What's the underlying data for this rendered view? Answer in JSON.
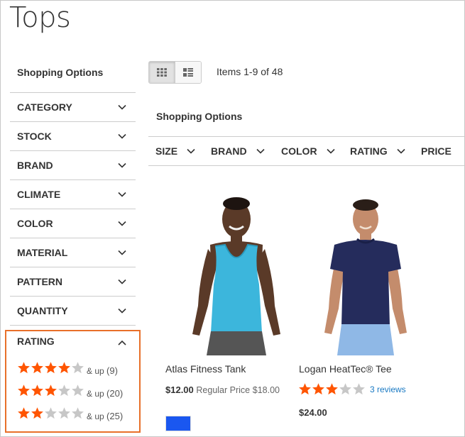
{
  "page": {
    "title": "Tops"
  },
  "sidebar": {
    "heading": "Shopping Options",
    "filters": [
      {
        "label": "CATEGORY"
      },
      {
        "label": "STOCK"
      },
      {
        "label": "BRAND"
      },
      {
        "label": "CLIMATE"
      },
      {
        "label": "COLOR"
      },
      {
        "label": "MATERIAL"
      },
      {
        "label": "PATTERN"
      },
      {
        "label": "QUANTITY"
      }
    ],
    "rating": {
      "label": "RATING",
      "expanded": true,
      "border_color": "#e8702a",
      "options": [
        {
          "stars": 4,
          "up_text": "& up",
          "count": "(9)"
        },
        {
          "stars": 3,
          "up_text": "& up",
          "count": "(20)"
        },
        {
          "stars": 2,
          "up_text": "& up",
          "count": "(25)"
        }
      ]
    }
  },
  "toolbar": {
    "view_modes": [
      "grid",
      "list"
    ],
    "active_mode": "grid",
    "items_count": "Items 1-9 of 48"
  },
  "top_filters": {
    "heading": "Shopping Options",
    "items": [
      {
        "label": "SIZE"
      },
      {
        "label": "BRAND"
      },
      {
        "label": "COLOR"
      },
      {
        "label": "RATING"
      },
      {
        "label": "PRICE"
      }
    ]
  },
  "products": [
    {
      "name": "Atlas Fitness Tank",
      "final_price": "$12.00",
      "regular_label": "Regular Price",
      "regular_price": "$18.00",
      "swatch_color": "#1a57f0"
    },
    {
      "name": "Logan HeatTec® Tee",
      "rating_stars": 3,
      "reviews": "3 reviews",
      "final_price": "$24.00"
    }
  ],
  "colors": {
    "star_active": "#ff5501",
    "star_inactive": "#c7c7c7",
    "link": "#1979c3",
    "highlight": "#e8702a"
  }
}
